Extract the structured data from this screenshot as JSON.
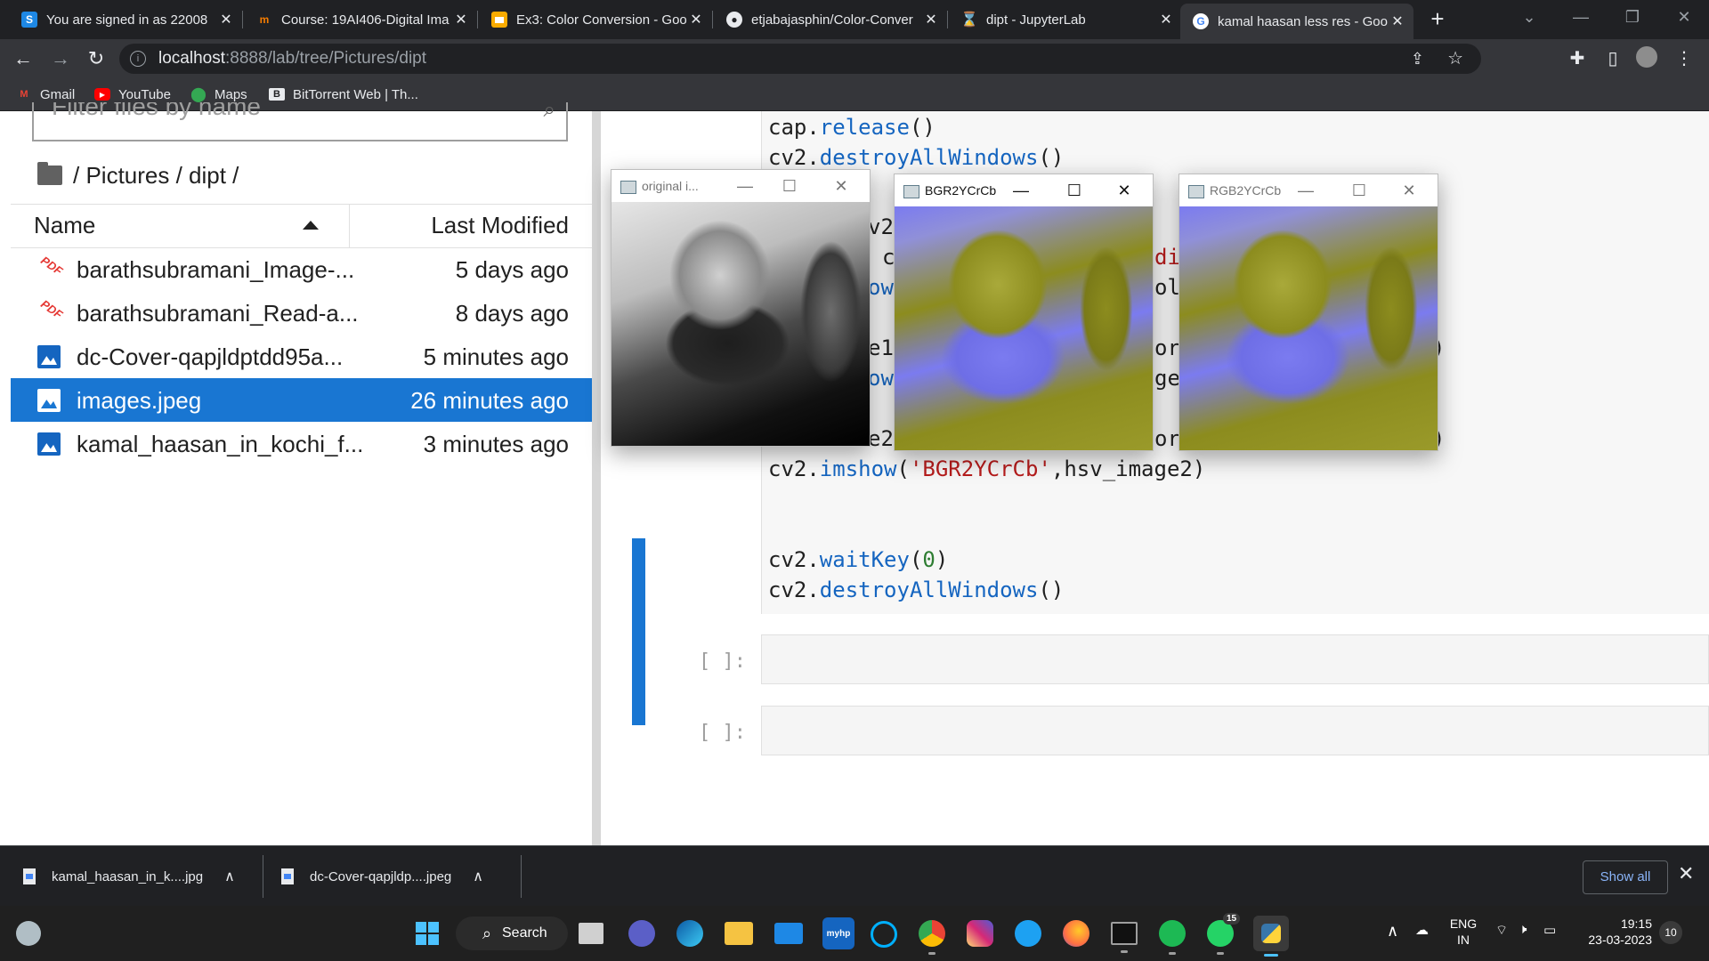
{
  "browser": {
    "tabs": [
      {
        "title": "You are signed in as 22008",
        "favicon": "S"
      },
      {
        "title": "Course: 19AI406-Digital Ima",
        "favicon": "m"
      },
      {
        "title": "Ex3: Color Conversion - Goo",
        "favicon": "slides"
      },
      {
        "title": "etjabajasphin/Color-Conver",
        "favicon": "github"
      },
      {
        "title": "dipt - JupyterLab",
        "favicon": "hourglass"
      },
      {
        "title": "kamal haasan less res - Goo",
        "favicon": "G"
      }
    ],
    "new_tab": "+",
    "url_host": "localhost",
    "url_rest": ":8888/lab/tree/Pictures/dipt",
    "bookmarks": [
      {
        "label": "Gmail"
      },
      {
        "label": "YouTube"
      },
      {
        "label": "Maps"
      },
      {
        "label": "BitTorrent Web | Th..."
      }
    ]
  },
  "filebrowser": {
    "filter_placeholder": "Filter files by name",
    "breadcrumb": "/ Pictures / dipt /",
    "col_name": "Name",
    "col_modified": "Last Modified",
    "files": [
      {
        "name": "barathsubramani_Image-...",
        "modified": "5 days ago",
        "type": "pdf"
      },
      {
        "name": "barathsubramani_Read-a...",
        "modified": "8 days ago",
        "type": "pdf"
      },
      {
        "name": "dc-Cover-qapjldptdd95a...",
        "modified": "5 minutes ago",
        "type": "image"
      },
      {
        "name": "images.jpeg",
        "modified": "26 minutes ago",
        "type": "image",
        "selected": true
      },
      {
        "name": "kamal_haasan_in_kochi_f...",
        "modified": "3 minutes ago",
        "type": "image"
      }
    ]
  },
  "notebook": {
    "line1_obj": "cap.",
    "line1_fn": "release",
    "line1_end": "()",
    "line2_obj": "cv2.",
    "line2_fn": "destroyAllWindows",
    "line2_end": "()",
    "partial_a": "v2",
    "partial_b": "c",
    "partial_c": "ow",
    "partial_d": "e1",
    "partial_e": "ow",
    "partial_f": "e2",
    "partial_g": "di",
    "partial_h": "ol",
    "partial_i": "or",
    "partial_j": "ge",
    "partial_k": "or",
    "partial_l": ")",
    "partial_m": ")",
    "imshow_obj": "cv2.",
    "imshow_fn": "imshow",
    "imshow_open": "(",
    "imshow_str": "'BGR2YCrCb'",
    "imshow_rest": ",hsv_image2)",
    "wait_obj": "cv2.",
    "wait_fn": "waitKey",
    "wait_open": "(",
    "wait_num": "0",
    "wait_close": ")",
    "destroy_obj": "cv2.",
    "destroy_fn": "destroyAllWindows",
    "destroy_end": "()",
    "empty_prompt": "[ ]:"
  },
  "windows": [
    {
      "title": "original i...",
      "active": false
    },
    {
      "title": "BGR2YCrCb",
      "active": true
    },
    {
      "title": "RGB2YCrCb",
      "active": false
    }
  ],
  "downloads": {
    "items": [
      {
        "name": "kamal_haasan_in_k....jpg"
      },
      {
        "name": "dc-Cover-qapjldp....jpeg"
      }
    ],
    "show_all": "Show all"
  },
  "taskbar": {
    "search": "Search",
    "whatsapp_badge": "15",
    "lang1": "ENG",
    "lang2": "IN",
    "time": "19:15",
    "date": "23-03-2023",
    "notif_count": "10"
  },
  "colors": {
    "accent_blue": "#1976d2",
    "ycrcb_olive": "#8c8c1e",
    "ycrcb_violet": "#7b7bf0"
  }
}
